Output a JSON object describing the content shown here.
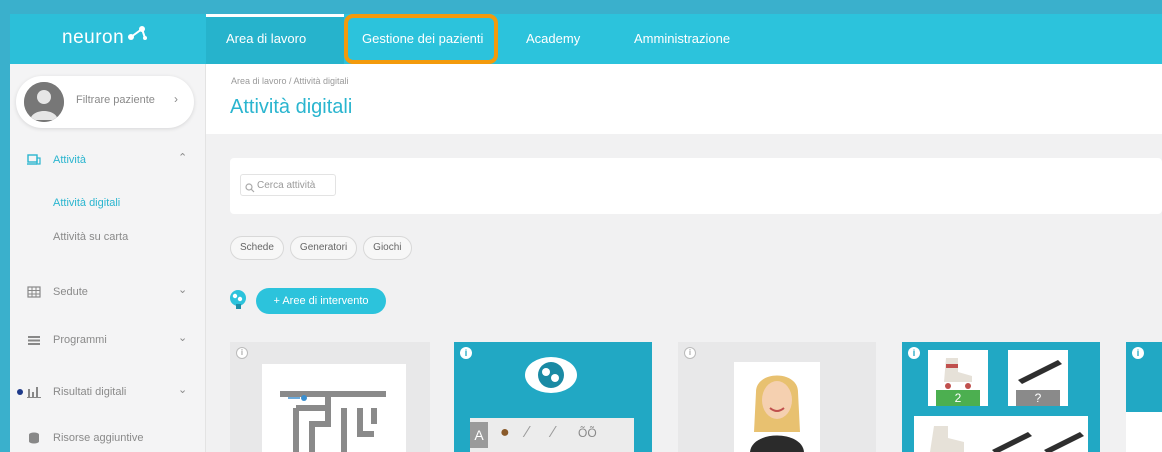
{
  "app": {
    "logo": "neuron"
  },
  "nav": {
    "items": [
      {
        "label": "Area di lavoro",
        "active": true
      },
      {
        "label": "Gestione dei pazienti",
        "active": false
      },
      {
        "label": "Academy",
        "active": false
      },
      {
        "label": "Amministrazione",
        "active": false
      }
    ]
  },
  "sidebar": {
    "patient_filter": "Filtrare paziente",
    "sections": {
      "attivita": "Attività",
      "attivita_digitali": "Attività digitali",
      "attivita_carta": "Attività su carta",
      "sedute": "Sedute",
      "programmi": "Programmi",
      "risultati": "Risultati digitali",
      "risorse": "Risorse aggiuntive"
    }
  },
  "main": {
    "breadcrumb": "Area di lavoro / Attività digitali",
    "title": "Attività digitali",
    "search_placeholder": "Cerca attività",
    "filters": [
      "Schede",
      "Generatori",
      "Giochi"
    ],
    "areas_button": "+ Aree di intervento",
    "cards": {
      "card4_numbers": [
        "2",
        "?"
      ],
      "card2_letter": "A"
    }
  },
  "colors": {
    "primary": "#2cc3dc",
    "highlight": "#f39a0c",
    "card_teal": "#21a8c4"
  }
}
